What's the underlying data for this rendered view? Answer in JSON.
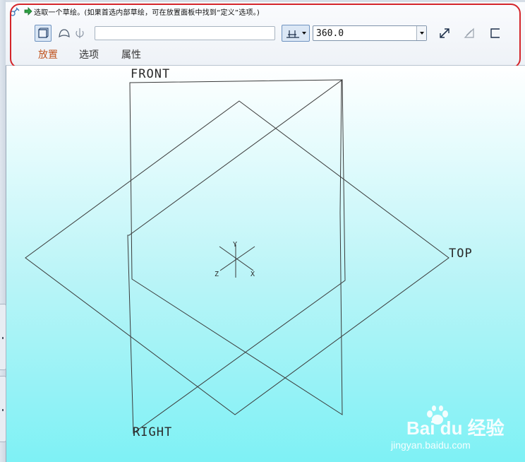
{
  "prompt": {
    "text": "选取一个草绘。(如果首选内部草绘，可在放置面板中找到“定义”选项。)"
  },
  "toolbar": {
    "sketch_placeholder": "",
    "angle_value": "360.0"
  },
  "tabs": [
    {
      "label": "放置",
      "active": true
    },
    {
      "label": "选项",
      "active": false
    },
    {
      "label": "属性",
      "active": false
    }
  ],
  "datum_planes": {
    "front": "FRONT",
    "top": "TOP",
    "right": "RIGHT"
  },
  "axes": {
    "x": "X",
    "y": "Y",
    "z": "Z"
  },
  "icons": {
    "pin": "pin-icon",
    "prompt_arrow": "green-arrow-icon",
    "solid": "solid-revolve-icon",
    "surface": "surface-revolve-icon",
    "axis": "axis-revolve-icon",
    "depth": "angle-depth-icon",
    "flip": "flip-direction-icon",
    "remove": "remove-material-icon",
    "thicken": "thicken-icon"
  },
  "colors": {
    "highlight": "#d4252a",
    "active_tab": "#c0541f",
    "graphics_top": "#ffffff",
    "graphics_bottom": "#7ef1f5"
  },
  "watermark": {
    "brand": "Bai du 经验",
    "url": "jingyan.baidu.com"
  }
}
